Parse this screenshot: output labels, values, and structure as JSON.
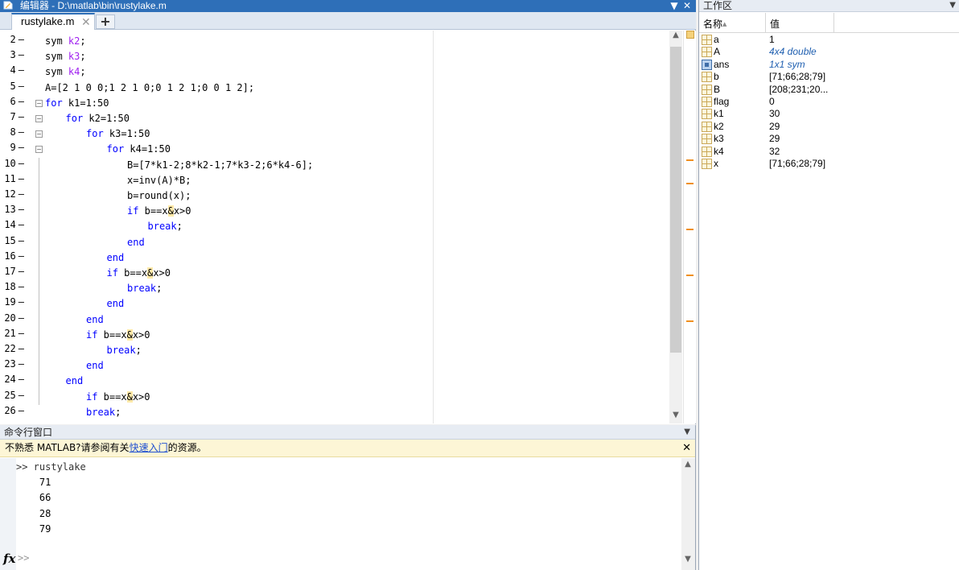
{
  "editor": {
    "title": "编辑器 - D:\\matlab\\bin\\rustylake.m",
    "tabs": [
      {
        "label": "rustylake.m"
      }
    ],
    "add_tab": "+",
    "close_glyph": "✕",
    "minimize_glyph": "▼"
  },
  "code_lines": [
    {
      "n": "2",
      "dash": "—",
      "indent": 1,
      "parts": [
        {
          "t": "sym ",
          "c": ""
        },
        {
          "t": "k2",
          "c": "pu"
        },
        {
          "t": ";",
          "c": ""
        }
      ]
    },
    {
      "n": "3",
      "dash": "—",
      "indent": 1,
      "parts": [
        {
          "t": "sym ",
          "c": ""
        },
        {
          "t": "k3",
          "c": "pu"
        },
        {
          "t": ";",
          "c": ""
        }
      ]
    },
    {
      "n": "4",
      "dash": "—",
      "indent": 1,
      "parts": [
        {
          "t": "sym ",
          "c": ""
        },
        {
          "t": "k4",
          "c": "pu"
        },
        {
          "t": ";",
          "c": ""
        }
      ]
    },
    {
      "n": "5",
      "dash": "—",
      "indent": 1,
      "parts": [
        {
          "t": "A=[2 1 0 0;1 2 1 0;0 1 2 1;0 0 1 2];",
          "c": ""
        }
      ]
    },
    {
      "n": "6",
      "dash": "—",
      "indent": 1,
      "parts": [
        {
          "t": "for",
          "c": "kw"
        },
        {
          "t": " k1=1:50",
          "c": ""
        }
      ]
    },
    {
      "n": "7",
      "dash": "—",
      "indent": 2,
      "parts": [
        {
          "t": "for",
          "c": "kw"
        },
        {
          "t": " k2=1:50",
          "c": ""
        }
      ]
    },
    {
      "n": "8",
      "dash": "—",
      "indent": 3,
      "parts": [
        {
          "t": "for",
          "c": "kw"
        },
        {
          "t": " k3=1:50",
          "c": ""
        }
      ]
    },
    {
      "n": "9",
      "dash": "—",
      "indent": 4,
      "parts": [
        {
          "t": "for",
          "c": "kw"
        },
        {
          "t": " k4=1:50",
          "c": ""
        }
      ]
    },
    {
      "n": "10",
      "dash": "—",
      "indent": 5,
      "parts": [
        {
          "t": "B=[7*k1-2;8*k2-1;7*k3-2;6*k4-6];",
          "c": ""
        }
      ]
    },
    {
      "n": "11",
      "dash": "—",
      "indent": 5,
      "parts": [
        {
          "t": "x=inv(A)*B;",
          "c": ""
        }
      ]
    },
    {
      "n": "12",
      "dash": "—",
      "indent": 5,
      "parts": [
        {
          "t": "b=round(x);",
          "c": ""
        }
      ]
    },
    {
      "n": "13",
      "dash": "—",
      "indent": 5,
      "parts": [
        {
          "t": "if",
          "c": "kw"
        },
        {
          "t": " b==x",
          "c": ""
        },
        {
          "t": "&",
          "c": "hl"
        },
        {
          "t": "x>0",
          "c": ""
        }
      ]
    },
    {
      "n": "14",
      "dash": "—",
      "indent": 6,
      "parts": [
        {
          "t": "break",
          "c": "kw"
        },
        {
          "t": ";",
          "c": ""
        }
      ]
    },
    {
      "n": "15",
      "dash": "—",
      "indent": 5,
      "parts": [
        {
          "t": "end",
          "c": "kw"
        }
      ]
    },
    {
      "n": "16",
      "dash": "—",
      "indent": 4,
      "parts": [
        {
          "t": "end",
          "c": "kw"
        }
      ]
    },
    {
      "n": "17",
      "dash": "—",
      "indent": 4,
      "parts": [
        {
          "t": "if",
          "c": "kw"
        },
        {
          "t": " b==x",
          "c": ""
        },
        {
          "t": "&",
          "c": "hl"
        },
        {
          "t": "x>0",
          "c": ""
        }
      ]
    },
    {
      "n": "18",
      "dash": "—",
      "indent": 5,
      "parts": [
        {
          "t": "break",
          "c": "kw"
        },
        {
          "t": ";",
          "c": ""
        }
      ]
    },
    {
      "n": "19",
      "dash": "—",
      "indent": 4,
      "parts": [
        {
          "t": "end",
          "c": "kw"
        }
      ]
    },
    {
      "n": "20",
      "dash": "—",
      "indent": 3,
      "parts": [
        {
          "t": "end",
          "c": "kw"
        }
      ]
    },
    {
      "n": "21",
      "dash": "—",
      "indent": 3,
      "parts": [
        {
          "t": "if",
          "c": "kw"
        },
        {
          "t": " b==x",
          "c": ""
        },
        {
          "t": "&",
          "c": "hl"
        },
        {
          "t": "x>0",
          "c": ""
        }
      ]
    },
    {
      "n": "22",
      "dash": "—",
      "indent": 4,
      "parts": [
        {
          "t": "break",
          "c": "kw"
        },
        {
          "t": ";",
          "c": ""
        }
      ]
    },
    {
      "n": "23",
      "dash": "—",
      "indent": 3,
      "parts": [
        {
          "t": "end",
          "c": "kw"
        }
      ]
    },
    {
      "n": "24",
      "dash": "—",
      "indent": 2,
      "parts": [
        {
          "t": "end",
          "c": "kw"
        }
      ]
    },
    {
      "n": "25",
      "dash": "—",
      "indent": 3,
      "parts": [
        {
          "t": "if",
          "c": "kw"
        },
        {
          "t": " b==x",
          "c": ""
        },
        {
          "t": "&",
          "c": "hl"
        },
        {
          "t": "x>0",
          "c": ""
        }
      ]
    },
    {
      "n": "26",
      "dash": "—",
      "indent": 3,
      "parts": [
        {
          "t": "break",
          "c": "kw"
        },
        {
          "t": ";",
          "c": ""
        }
      ]
    }
  ],
  "workspace": {
    "title": "工作区",
    "col_name": "名称",
    "sort_glyph": "▲",
    "col_value": "值",
    "menu_glyph": "▼",
    "vars": [
      {
        "name": "a",
        "value": "1",
        "icon": "grid",
        "italic": false
      },
      {
        "name": "A",
        "value": "4x4 double",
        "icon": "grid",
        "italic": true
      },
      {
        "name": "ans",
        "value": "1x1 sym",
        "icon": "sym",
        "italic": true
      },
      {
        "name": "b",
        "value": "[71;66;28;79]",
        "icon": "grid",
        "italic": false
      },
      {
        "name": "B",
        "value": "[208;231;20...",
        "icon": "grid",
        "italic": false
      },
      {
        "name": "flag",
        "value": "0",
        "icon": "grid",
        "italic": false
      },
      {
        "name": "k1",
        "value": "30",
        "icon": "grid",
        "italic": false
      },
      {
        "name": "k2",
        "value": "29",
        "icon": "grid",
        "italic": false
      },
      {
        "name": "k3",
        "value": "29",
        "icon": "grid",
        "italic": false
      },
      {
        "name": "k4",
        "value": "32",
        "icon": "grid",
        "italic": false
      },
      {
        "name": "x",
        "value": "[71;66;28;79]",
        "icon": "grid",
        "italic": false
      }
    ]
  },
  "command": {
    "title": "命令行窗口",
    "menu_glyph": "▼",
    "notice_prefix": "不熟悉 MATLAB?请参阅有关",
    "notice_link": "快速入门",
    "notice_suffix": "的资源。",
    "notice_close": "✕",
    "lines": [
      ">> rustylake",
      "    71",
      "    66",
      "    28",
      "    79"
    ],
    "fx": "fx",
    "prompt": ">>"
  },
  "colors": {
    "title_bar": "#2e6fb8",
    "keyword": "#0000ff",
    "purple": "#a020f0",
    "highlight": "#ffe9a8",
    "marker": "#f09020"
  }
}
